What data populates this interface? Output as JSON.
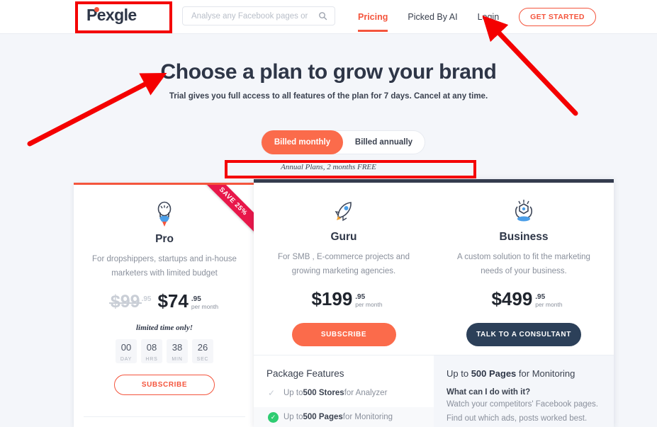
{
  "header": {
    "logo": "Pexgle",
    "logo_icon": "logo-dot",
    "search": {
      "placeholder": "Analyse any Facebook pages or stores",
      "value": "",
      "icon": "search-icon"
    },
    "nav": [
      {
        "label": "Pricing",
        "active": true
      },
      {
        "label": "Picked By AI",
        "active": false
      },
      {
        "label": "Login",
        "active": false
      }
    ],
    "cta": "GET STARTED"
  },
  "hero": {
    "title": "Choose a plan to grow your brand",
    "subtitle": "Trial gives you full access to all features of the plan for 7 days. Cancel at any time."
  },
  "billing": {
    "options": [
      "Billed monthly",
      "Billed annually"
    ],
    "selected": "Billed monthly",
    "note": "Annual Plans, 2 months FREE"
  },
  "plans": {
    "pro": {
      "ribbon": "SAVE 25%",
      "icon": "lightbulb-rocket-icon",
      "name": "Pro",
      "description": "For dropshippers, startups and in-house marketers with limited budget",
      "price_old": "$99",
      "price_old_cents": ".95",
      "price_new": "$74",
      "price_cents": ".95",
      "price_period": "per month",
      "limited_text": "limited time only!",
      "countdown": [
        {
          "value": "00",
          "label": "DAY"
        },
        {
          "value": "08",
          "label": "HRS"
        },
        {
          "value": "38",
          "label": "MIN"
        },
        {
          "value": "26",
          "label": "SEC"
        }
      ],
      "cta": "SUBSCRIBE"
    },
    "guru": {
      "icon": "rocket-icon",
      "name": "Guru",
      "description": "For SMB , E-commerce projects and growing marketing agencies.",
      "price": "$199",
      "price_cents": ".95",
      "price_period": "per month",
      "cta": "SUBSCRIBE"
    },
    "business": {
      "icon": "hands-box-icon",
      "name": "Business",
      "description": "A custom solution to fit the marketing needs of your business.",
      "price": "$499",
      "price_cents": ".95",
      "price_period": "per month",
      "cta": "TALK TO A CONSULTANT"
    }
  },
  "features": {
    "title": "Package Features",
    "items": [
      {
        "check": "check-grey-icon",
        "prefix": "Up to ",
        "bold": "500 Stores",
        "suffix": " for Analyzer",
        "highlighted": false
      },
      {
        "check": "check-green-icon",
        "prefix": "Up to ",
        "bold": "500 Pages",
        "suffix": " for Monitoring",
        "highlighted": true
      }
    ]
  },
  "info_panel": {
    "title_prefix": "Up to ",
    "title_bold": "500 Pages",
    "title_suffix": " for Monitoring",
    "question": "What can I do with it?",
    "line1": "Watch your competitors' Facebook pages.",
    "line2": "Find out which ads, posts worked best."
  },
  "colors": {
    "accent": "#f4553d",
    "accent_soft": "#fb6b4b",
    "dark": "#2e3647",
    "navy_button": "#2c4059",
    "ribbon": "#e8174a",
    "page_bg": "#f4f6fa",
    "annotation": "#f40000",
    "green": "#2ecc71"
  }
}
